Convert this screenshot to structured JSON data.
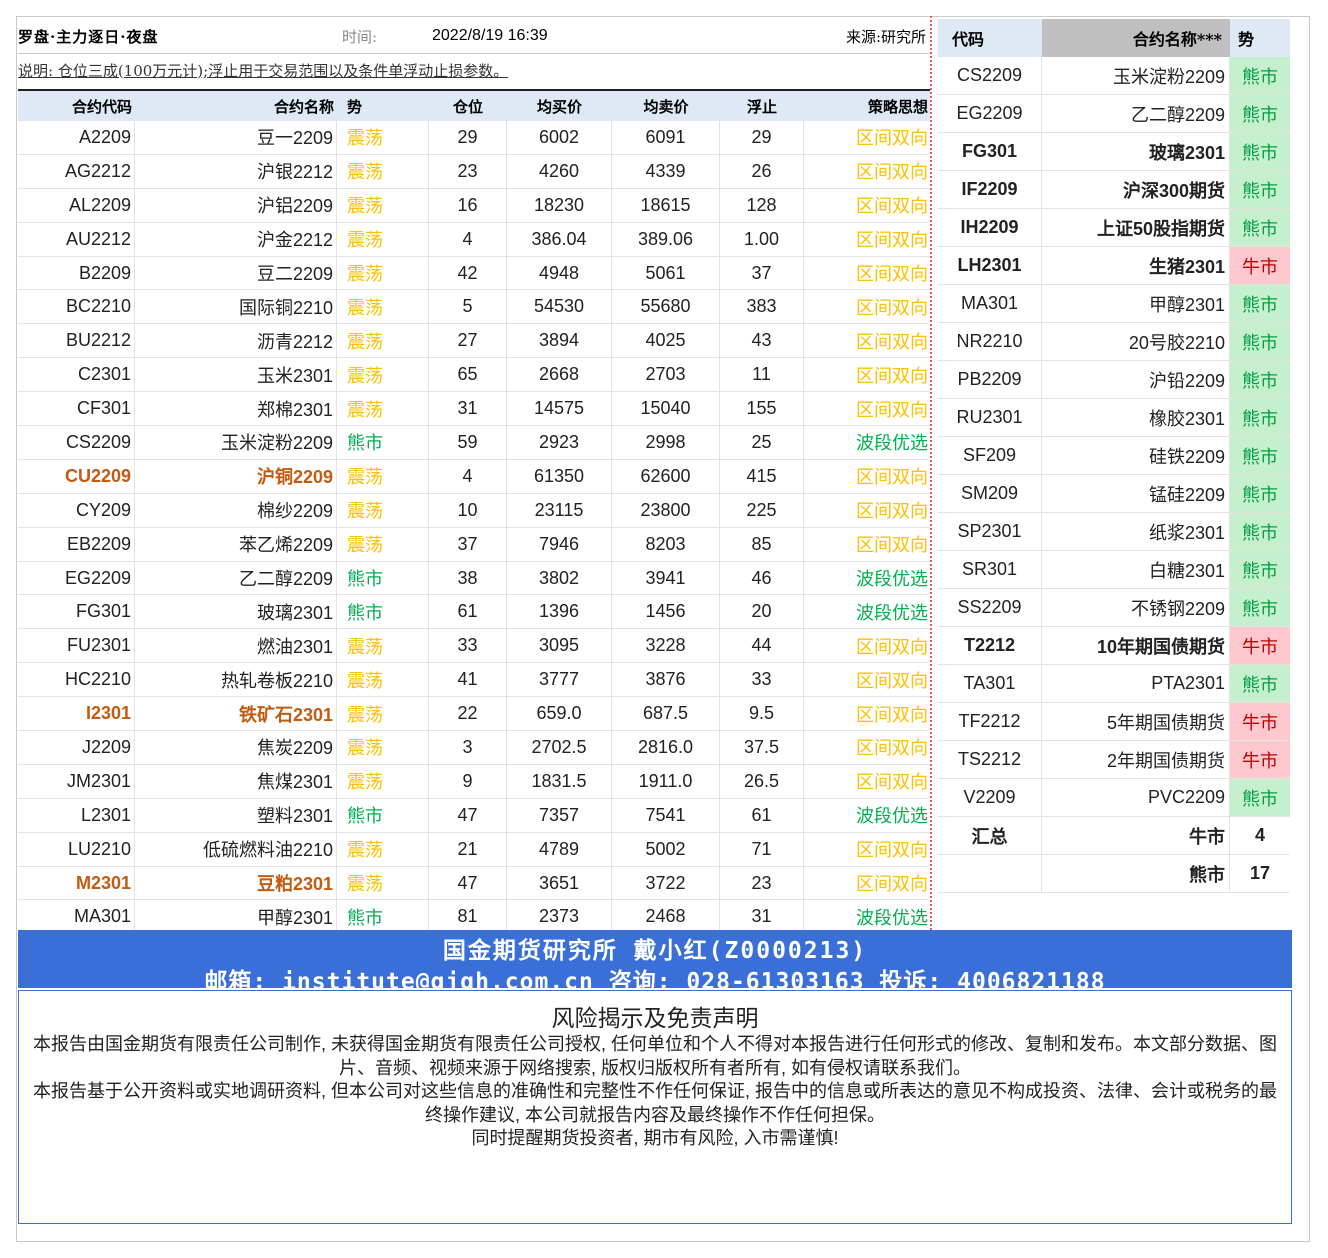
{
  "header": {
    "title": "罗盘·主力逐日·夜盘",
    "time_label": "时间:",
    "time_value": "2022/8/19 16:39",
    "source": "来源:研究所",
    "note": "说明: 仓位三成(100万元计);浮止用于交易范围以及条件单浮动止损参数。"
  },
  "table": {
    "columns": [
      "合约代码",
      "合约名称",
      "势",
      "仓位",
      "均买价",
      "均卖价",
      "浮止",
      "策略思想"
    ],
    "rows": [
      {
        "code": "A2209",
        "name": "豆一2209",
        "trend": "震荡",
        "pos": "29",
        "buy": "6002",
        "sell": "6091",
        "stop": "29",
        "strategy": "区间双向",
        "hl": false
      },
      {
        "code": "AG2212",
        "name": "沪银2212",
        "trend": "震荡",
        "pos": "23",
        "buy": "4260",
        "sell": "4339",
        "stop": "26",
        "strategy": "区间双向",
        "hl": false
      },
      {
        "code": "AL2209",
        "name": "沪铝2209",
        "trend": "震荡",
        "pos": "16",
        "buy": "18230",
        "sell": "18615",
        "stop": "128",
        "strategy": "区间双向",
        "hl": false
      },
      {
        "code": "AU2212",
        "name": "沪金2212",
        "trend": "震荡",
        "pos": "4",
        "buy": "386.04",
        "sell": "389.06",
        "stop": "1.00",
        "strategy": "区间双向",
        "hl": false
      },
      {
        "code": "B2209",
        "name": "豆二2209",
        "trend": "震荡",
        "pos": "42",
        "buy": "4948",
        "sell": "5061",
        "stop": "37",
        "strategy": "区间双向",
        "hl": false
      },
      {
        "code": "BC2210",
        "name": "国际铜2210",
        "trend": "震荡",
        "pos": "5",
        "buy": "54530",
        "sell": "55680",
        "stop": "383",
        "strategy": "区间双向",
        "hl": false
      },
      {
        "code": "BU2212",
        "name": "沥青2212",
        "trend": "震荡",
        "pos": "27",
        "buy": "3894",
        "sell": "4025",
        "stop": "43",
        "strategy": "区间双向",
        "hl": false
      },
      {
        "code": "C2301",
        "name": "玉米2301",
        "trend": "震荡",
        "pos": "65",
        "buy": "2668",
        "sell": "2703",
        "stop": "11",
        "strategy": "区间双向",
        "hl": false
      },
      {
        "code": "CF301",
        "name": "郑棉2301",
        "trend": "震荡",
        "pos": "31",
        "buy": "14575",
        "sell": "15040",
        "stop": "155",
        "strategy": "区间双向",
        "hl": false
      },
      {
        "code": "CS2209",
        "name": "玉米淀粉2209",
        "trend": "熊市",
        "pos": "59",
        "buy": "2923",
        "sell": "2998",
        "stop": "25",
        "strategy": "波段优选",
        "hl": false
      },
      {
        "code": "CU2209",
        "name": "沪铜2209",
        "trend": "震荡",
        "pos": "4",
        "buy": "61350",
        "sell": "62600",
        "stop": "415",
        "strategy": "区间双向",
        "hl": true
      },
      {
        "code": "CY209",
        "name": "棉纱2209",
        "trend": "震荡",
        "pos": "10",
        "buy": "23115",
        "sell": "23800",
        "stop": "225",
        "strategy": "区间双向",
        "hl": false
      },
      {
        "code": "EB2209",
        "name": "苯乙烯2209",
        "trend": "震荡",
        "pos": "37",
        "buy": "7946",
        "sell": "8203",
        "stop": "85",
        "strategy": "区间双向",
        "hl": false
      },
      {
        "code": "EG2209",
        "name": "乙二醇2209",
        "trend": "熊市",
        "pos": "38",
        "buy": "3802",
        "sell": "3941",
        "stop": "46",
        "strategy": "波段优选",
        "hl": false
      },
      {
        "code": "FG301",
        "name": "玻璃2301",
        "trend": "熊市",
        "pos": "61",
        "buy": "1396",
        "sell": "1456",
        "stop": "20",
        "strategy": "波段优选",
        "hl": false
      },
      {
        "code": "FU2301",
        "name": "燃油2301",
        "trend": "震荡",
        "pos": "33",
        "buy": "3095",
        "sell": "3228",
        "stop": "44",
        "strategy": "区间双向",
        "hl": false
      },
      {
        "code": "HC2210",
        "name": "热轧卷板2210",
        "trend": "震荡",
        "pos": "41",
        "buy": "3777",
        "sell": "3876",
        "stop": "33",
        "strategy": "区间双向",
        "hl": false
      },
      {
        "code": "I2301",
        "name": "铁矿石2301",
        "trend": "震荡",
        "pos": "22",
        "buy": "659.0",
        "sell": "687.5",
        "stop": "9.5",
        "strategy": "区间双向",
        "hl": true
      },
      {
        "code": "J2209",
        "name": "焦炭2209",
        "trend": "震荡",
        "pos": "3",
        "buy": "2702.5",
        "sell": "2816.0",
        "stop": "37.5",
        "strategy": "区间双向",
        "hl": false
      },
      {
        "code": "JM2301",
        "name": "焦煤2301",
        "trend": "震荡",
        "pos": "9",
        "buy": "1831.5",
        "sell": "1911.0",
        "stop": "26.5",
        "strategy": "区间双向",
        "hl": false
      },
      {
        "code": "L2301",
        "name": "塑料2301",
        "trend": "熊市",
        "pos": "47",
        "buy": "7357",
        "sell": "7541",
        "stop": "61",
        "strategy": "波段优选",
        "hl": false
      },
      {
        "code": "LU2210",
        "name": "低硫燃料油2210",
        "trend": "震荡",
        "pos": "21",
        "buy": "4789",
        "sell": "5002",
        "stop": "71",
        "strategy": "区间双向",
        "hl": false
      },
      {
        "code": "M2301",
        "name": "豆粕2301",
        "trend": "震荡",
        "pos": "47",
        "buy": "3651",
        "sell": "3722",
        "stop": "23",
        "strategy": "区间双向",
        "hl": true
      },
      {
        "code": "MA301",
        "name": "甲醇2301",
        "trend": "熊市",
        "pos": "81",
        "buy": "2373",
        "sell": "2468",
        "stop": "31",
        "strategy": "波段优选",
        "hl": false
      }
    ]
  },
  "side": {
    "columns": [
      "代码",
      "合约名称***",
      "势"
    ],
    "rows": [
      {
        "code": "CS2209",
        "name": "玉米淀粉2209",
        "trend": "熊市",
        "hl": false
      },
      {
        "code": "EG2209",
        "name": "乙二醇2209",
        "trend": "熊市",
        "hl": false
      },
      {
        "code": "FG301",
        "name": "玻璃2301",
        "trend": "熊市",
        "hl": true
      },
      {
        "code": "IF2209",
        "name": "沪深300期货",
        "trend": "熊市",
        "hl": true
      },
      {
        "code": "IH2209",
        "name": "上证50股指期货",
        "trend": "熊市",
        "hl": true
      },
      {
        "code": "LH2301",
        "name": "生猪2301",
        "trend": "牛市",
        "hl": true
      },
      {
        "code": "MA301",
        "name": "甲醇2301",
        "trend": "熊市",
        "hl": false
      },
      {
        "code": "NR2210",
        "name": "20号胶2210",
        "trend": "熊市",
        "hl": false
      },
      {
        "code": "PB2209",
        "name": "沪铅2209",
        "trend": "熊市",
        "hl": false
      },
      {
        "code": "RU2301",
        "name": "橡胶2301",
        "trend": "熊市",
        "hl": false
      },
      {
        "code": "SF209",
        "name": "硅铁2209",
        "trend": "熊市",
        "hl": false
      },
      {
        "code": "SM209",
        "name": "锰硅2209",
        "trend": "熊市",
        "hl": false
      },
      {
        "code": "SP2301",
        "name": "纸浆2301",
        "trend": "熊市",
        "hl": false
      },
      {
        "code": "SR301",
        "name": "白糖2301",
        "trend": "熊市",
        "hl": false
      },
      {
        "code": "SS2209",
        "name": "不锈钢2209",
        "trend": "熊市",
        "hl": false
      },
      {
        "code": "T2212",
        "name": "10年期国债期货",
        "trend": "牛市",
        "hl": true
      },
      {
        "code": "TA301",
        "name": "PTA2301",
        "trend": "熊市",
        "hl": false
      },
      {
        "code": "TF2212",
        "name": "5年期国债期货",
        "trend": "牛市",
        "hl": false
      },
      {
        "code": "TS2212",
        "name": "2年期国债期货",
        "trend": "牛市",
        "hl": false
      },
      {
        "code": "V2209",
        "name": "PVC2209",
        "trend": "熊市",
        "hl": false
      }
    ],
    "summary_label": "汇总",
    "summary": [
      {
        "label": "牛市",
        "count": "4"
      },
      {
        "label": "熊市",
        "count": "17"
      }
    ]
  },
  "banner": {
    "line1": "国金期货研究所  戴小红(Z0000213)",
    "line2": "邮箱: institute@gjqh.com.cn 咨询: 028-61303163 投诉: 4006821188"
  },
  "disclaimer": {
    "title": "风险揭示及免责声明",
    "p1": "本报告由国金期货有限责任公司制作, 未获得国金期货有限责任公司授权, 任何单位和个人不得对本报告进行任何形式的修改、复制和发布。本文部分数据、图片、音频、视频来源于网络搜索, 版权归版权所有者所有, 如有侵权请联系我们。",
    "p2": "本报告基于公开资料或实地调研资料, 但本公司对这些信息的准确性和完整性不作任何保证, 报告中的信息或所表达的意见不构成投资、法律、会计或税务的最终操作建议, 本公司就报告内容及最终操作不作任何担保。",
    "p3": "同时提醒期货投资者, 期市有风险, 入市需谨慎!"
  },
  "colors": {
    "highlight": "#c55a11",
    "trend_range": "#ffc000",
    "trend_bear": "#00b050",
    "bull_bg": "#ffc7ce",
    "bear_bg": "#c6efce",
    "banner": "#3a6fd8"
  }
}
